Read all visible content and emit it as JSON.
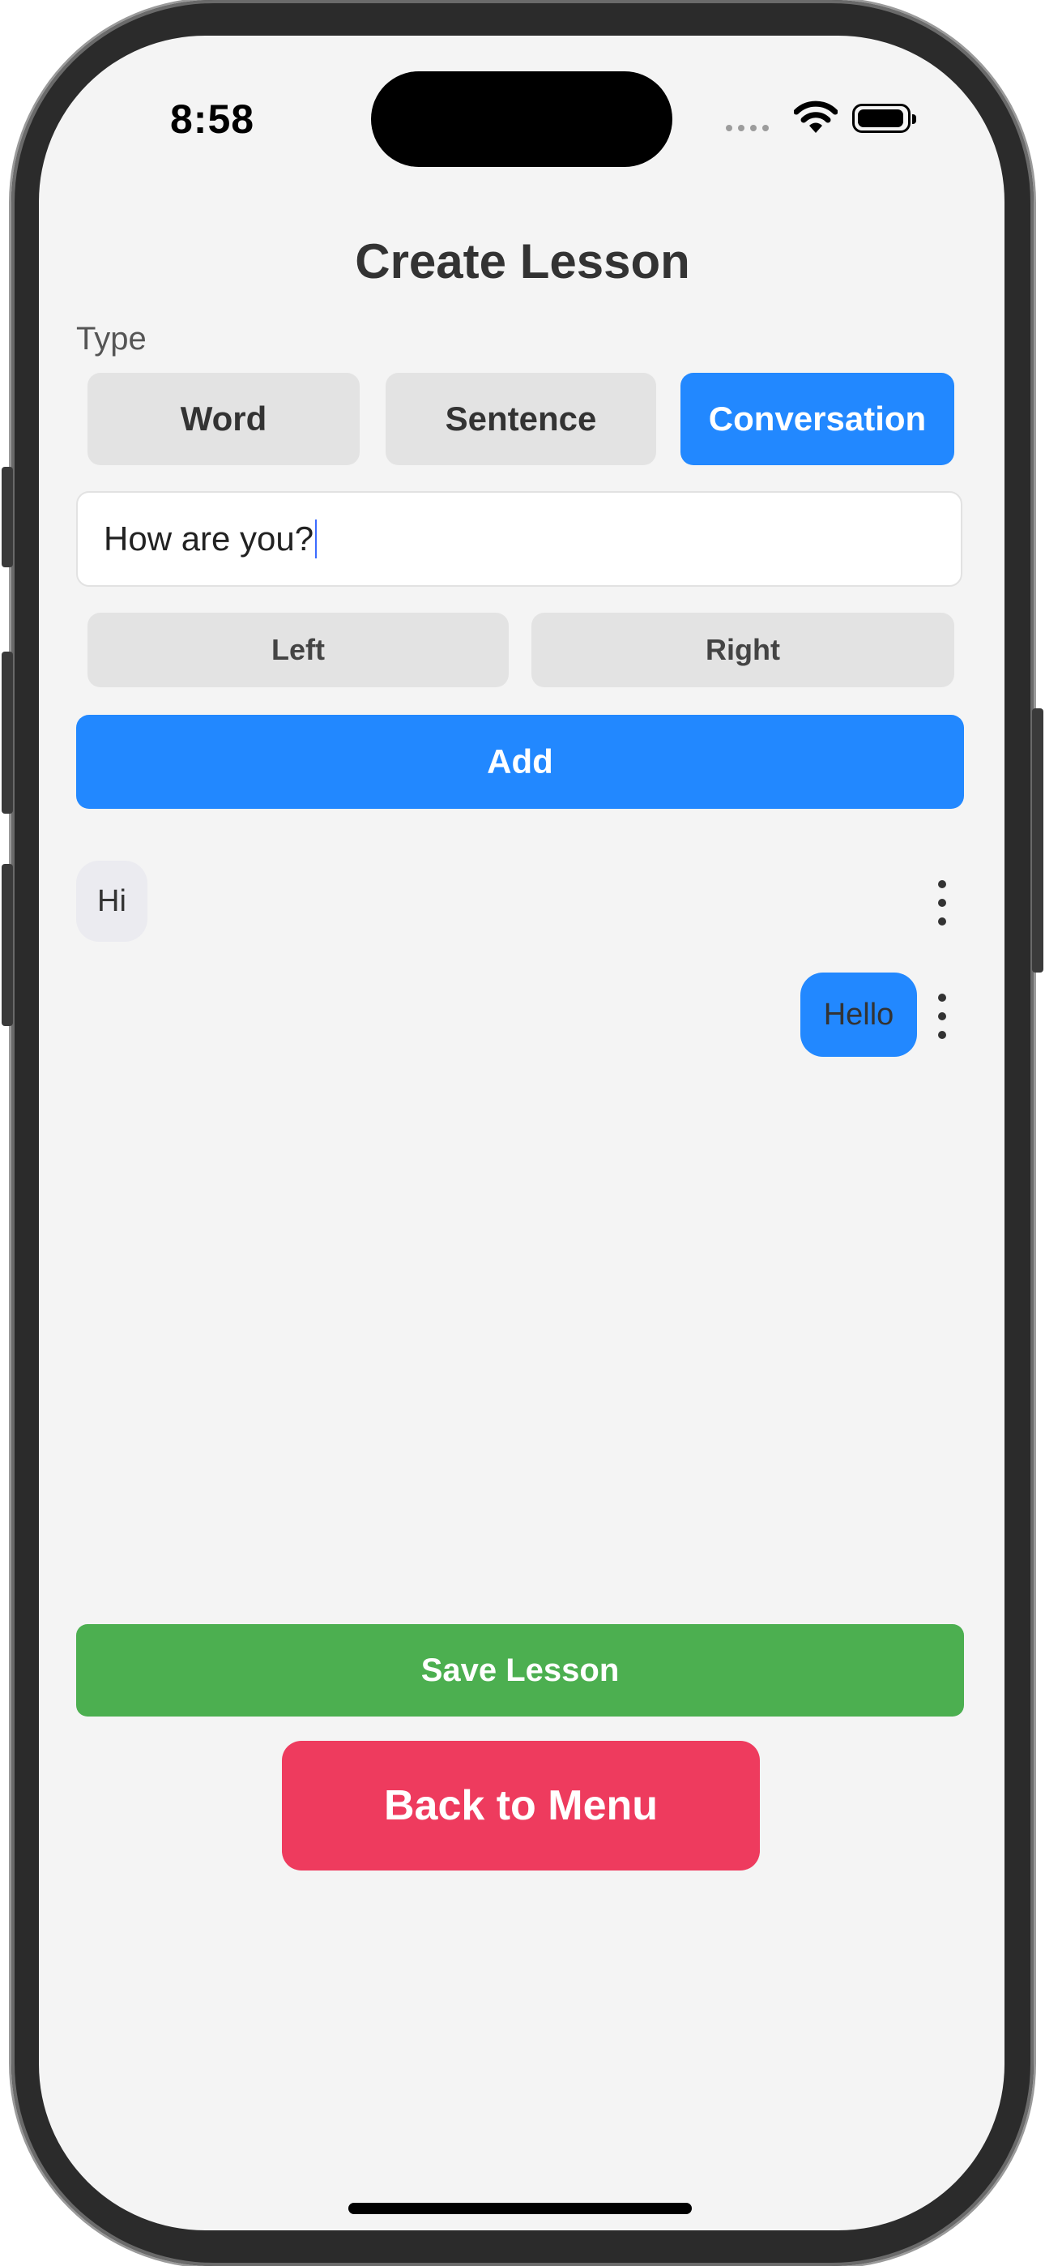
{
  "status_bar": {
    "time": "8:58"
  },
  "screen": {
    "title": "Create Lesson"
  },
  "type_selector": {
    "label": "Type",
    "options": [
      {
        "label": "Word",
        "selected": false
      },
      {
        "label": "Sentence",
        "selected": false
      },
      {
        "label": "Conversation",
        "selected": true
      }
    ]
  },
  "message_input": {
    "value": "How are you?"
  },
  "side_selector": {
    "left_label": "Left",
    "right_label": "Right"
  },
  "actions": {
    "add_label": "Add",
    "save_label": "Save Lesson",
    "back_label": "Back to Menu"
  },
  "conversation": [
    {
      "side": "left",
      "text": "Hi"
    },
    {
      "side": "right",
      "text": "Hello"
    }
  ],
  "colors": {
    "accent_blue": "#2288ff",
    "save_green": "#4caf50",
    "back_red": "#ee3b5e",
    "background": "#f4f4f4"
  }
}
